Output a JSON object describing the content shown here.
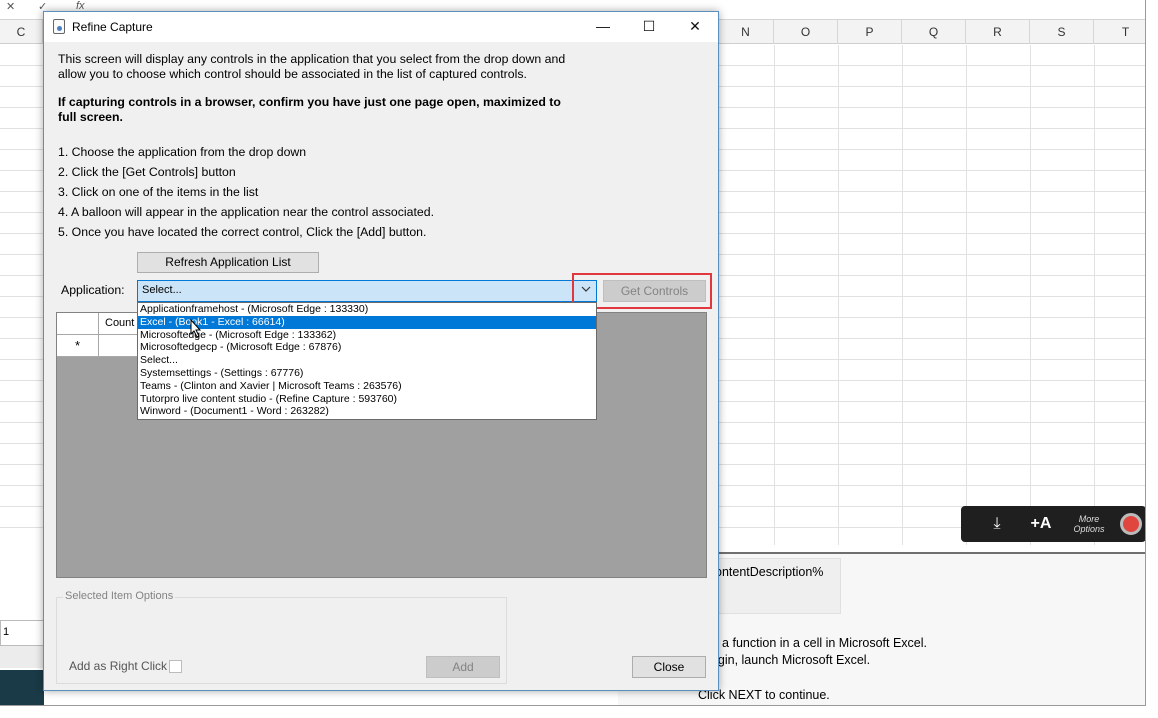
{
  "excel": {
    "formula_fx": "fx",
    "row_cell_c": "C",
    "columns": [
      "N",
      "O",
      "P",
      "Q",
      "R",
      "S",
      "T"
    ],
    "bottom_panel": {
      "field": "ontentDescription%",
      "line1": "ert a function in a cell in Microsoft Excel.",
      "line2": "begin, launch Microsoft Excel.",
      "line3": "Click NEXT to continue."
    },
    "sheet_tab": "1"
  },
  "recorder_toolbar": {
    "more_label": "More\nOptions"
  },
  "dialog": {
    "title": "Refine Capture",
    "controls": {
      "minimize": "—",
      "maximize": "☐",
      "close": "✕"
    },
    "intro_line1": "This screen will display any controls in the application that you select from the drop down and",
    "intro_line2": "allow you to choose which control should be associated in the list of captured controls.",
    "warning_line1": "If capturing controls in a browser, confirm you have just one page open, maximized to",
    "warning_line2": "full screen.",
    "steps": [
      "1. Choose the application from the drop down",
      "2. Click the [Get Controls] button",
      "3. Click on one of the items in the list",
      "4. A balloon will appear in the application near the control associated.",
      "5. Once you have located the correct control, Click the [Add] button."
    ],
    "refresh_button": "Refresh Application List",
    "application_label": "Application:",
    "application_value": "Select...",
    "get_controls_button": "Get Controls",
    "dropdown_options": [
      "Applicationframehost - (Microsoft Edge : 133330)",
      "Excel - (Book1 - Excel : 66614)",
      "Microsoftedge - (Microsoft Edge : 133362)",
      "Microsoftedgecp - (Microsoft Edge : 67876)",
      "Select...",
      "Systemsettings - (Settings : 67776)",
      "Teams - (Clinton and Xavier | Microsoft Teams : 263576)",
      "Tutorpro live content studio - (Refine Capture : 593760)",
      "Winword - (Document1 - Word : 263282)"
    ],
    "selected_option_index": 1,
    "grid": {
      "column_header": "Count",
      "new_row_marker": "*"
    },
    "selected_item_options": "Selected Item Options",
    "add_right_click_label": "Add as Right Click",
    "add_button": "Add",
    "close_button": "Close"
  }
}
